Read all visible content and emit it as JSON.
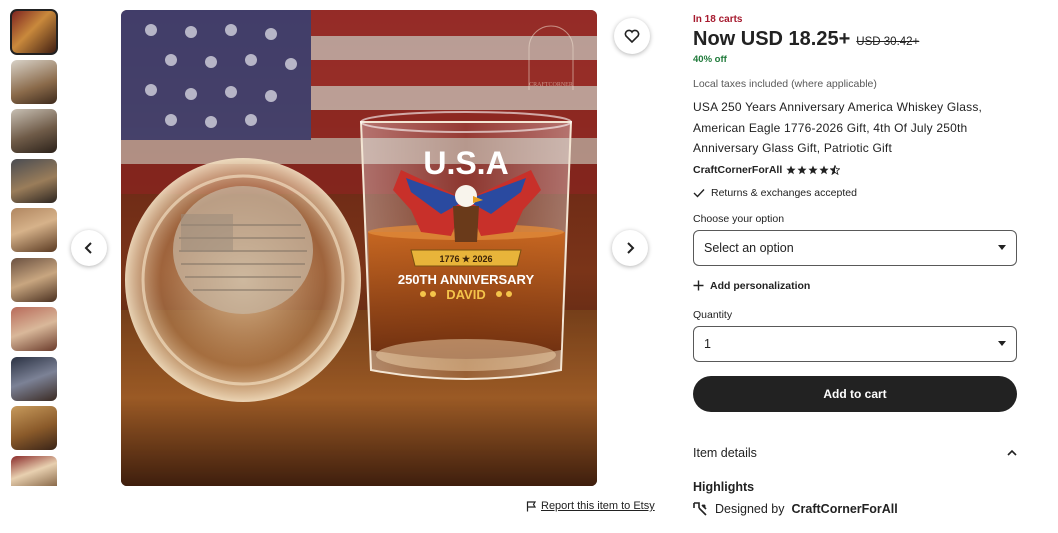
{
  "gallery": {
    "thumbnail_count": 10,
    "report_link": "Report this item to Etsy"
  },
  "image": {
    "watermark": "CRAFTCORNER",
    "glass_heading": "U.S.A",
    "banner_years": "1776 ★ 2026",
    "anniversary": "250TH ANNIVERSARY",
    "name": "DAVID"
  },
  "listing": {
    "in_carts": "In 18 carts",
    "price_now": "Now USD 18.25+",
    "price_old": "USD 30.42+",
    "discount": "40% off",
    "taxes": "Local taxes included (where applicable)",
    "title": "USA 250 Years Anniversary America Whiskey Glass, American Eagle 1776-2026 Gift, 4th Of July 250th Anniversary Glass Gift, Patriotic Gift",
    "shop_name": "CraftCornerForAll",
    "rating": 4.5,
    "returns": "Returns & exchanges accepted",
    "option_label": "Choose your option",
    "option_value": "Select an option",
    "add_personalization": "Add personalization",
    "quantity_label": "Quantity",
    "quantity_value": "1",
    "add_to_cart": "Add to cart",
    "item_details": "Item details",
    "highlights": "Highlights",
    "designed_by_prefix": "Designed by",
    "designed_by_shop": "CraftCornerForAll"
  },
  "colors": {
    "accent_red": "#a61a2e",
    "discount_green": "#1f7a3a",
    "button_dark": "#222222"
  }
}
